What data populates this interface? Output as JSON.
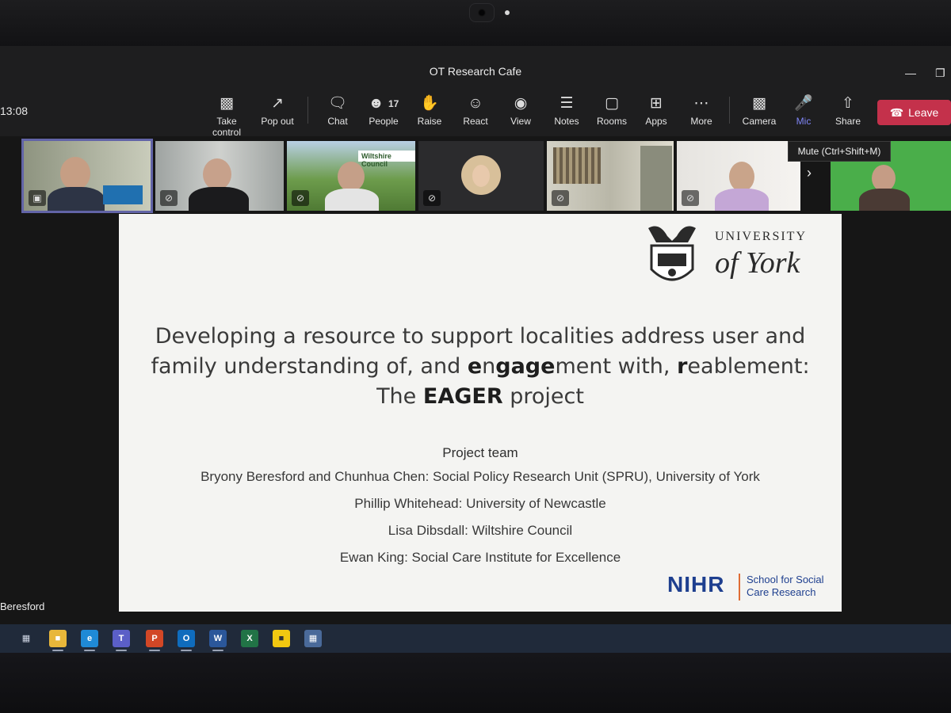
{
  "window": {
    "title": "OT Research Cafe"
  },
  "toolbar": {
    "time": "13:08",
    "take_control": "Take control",
    "pop_out": "Pop out",
    "chat": "Chat",
    "people": "People",
    "people_count": "17",
    "raise": "Raise",
    "react": "React",
    "view": "View",
    "notes": "Notes",
    "rooms": "Rooms",
    "apps": "Apps",
    "more": "More",
    "camera": "Camera",
    "mic": "Mic",
    "share": "Share",
    "leave": "Leave",
    "mic_tooltip": "Mute (Ctrl+Shift+M)"
  },
  "participants": {
    "tile3_sign": "Wiltshire Council",
    "speaker_name": "Beresford"
  },
  "slide": {
    "uni_line1": "UNIVERSITY",
    "uni_line2": "of York",
    "title_part1": "Developing a resource to support localities address user and family understanding of, and ",
    "title_bold1": "e",
    "title_part2": "n",
    "title_bold2": "g",
    "title_part3": "",
    "title_bold3": "age",
    "title_part4": "ment with, ",
    "title_bold4": "r",
    "title_part5": "eablement: The ",
    "title_bold5": "EAGER",
    "title_part6": " project",
    "team_heading": "Project team",
    "team": [
      "Bryony Beresford and Chunhua Chen: Social Policy Research Unit (SPRU), University of York",
      "Phillip Whitehead: University of Newcastle",
      "Lisa Dibsdall: Wiltshire Council",
      "Ewan King: Social Care Institute for Excellence"
    ],
    "nihr": "NIHR",
    "nihr_sub1": "School for Social",
    "nihr_sub2": "Care Research"
  },
  "colors": {
    "accent": "#6264a7",
    "leave": "#c4314b",
    "nihr_blue": "#1e3f8f"
  }
}
